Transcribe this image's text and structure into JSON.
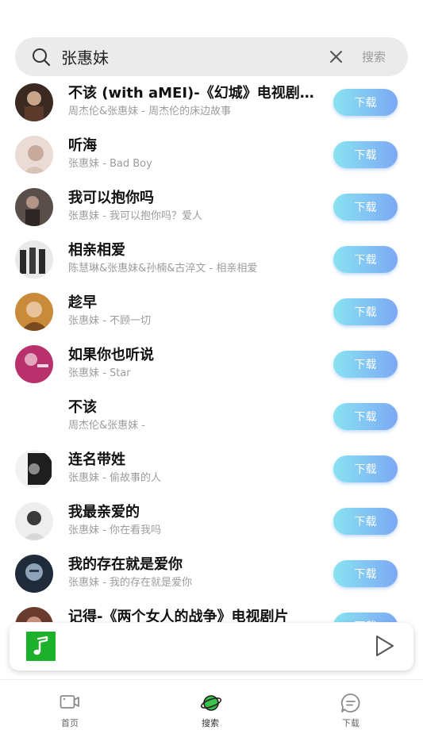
{
  "search": {
    "query": "张惠妹",
    "submit_label": "搜索"
  },
  "songs": [
    {
      "title": "不该 (with aMEI)-《幻城》电视剧片尾曲",
      "subtitle": "周杰伦&张惠妹 - 周杰伦的床边故事",
      "download_label": "下载"
    },
    {
      "title": "听海",
      "subtitle": "张惠妹 - Bad Boy",
      "download_label": "下载"
    },
    {
      "title": "我可以抱你吗",
      "subtitle": "张惠妹 - 我可以抱你吗？爱人",
      "download_label": "下载"
    },
    {
      "title": "相亲相爱",
      "subtitle": "陈慧琳&张惠妹&孙楠&古淬文 - 相亲相爱",
      "download_label": "下载"
    },
    {
      "title": "趁早",
      "subtitle": "张惠妹 - 不顾一切",
      "download_label": "下载"
    },
    {
      "title": "如果你也听说",
      "subtitle": "张惠妹 - Star",
      "download_label": "下载"
    },
    {
      "title": "不该",
      "subtitle": "周杰伦&张惠妹 -",
      "download_label": "下载"
    },
    {
      "title": "连名带姓",
      "subtitle": "张惠妹 - 偷故事的人",
      "download_label": "下载"
    },
    {
      "title": "我最亲爱的",
      "subtitle": "张惠妹 - 你在看我吗",
      "download_label": "下载"
    },
    {
      "title": "我的存在就是爱你",
      "subtitle": "张惠妹 - 我的存在就是爱你",
      "download_label": "下载"
    },
    {
      "title": "记得-《两个女人的战争》电视剧片",
      "subtitle": "",
      "download_label": "下载"
    }
  ],
  "player": {
    "art_icon": "music-note-icon",
    "play_icon": "play-icon"
  },
  "tabs": [
    {
      "label": "首页",
      "icon": "video-icon"
    },
    {
      "label": "搜索",
      "icon": "planet-icon"
    },
    {
      "label": "下载",
      "icon": "chat-icon"
    }
  ],
  "colors": {
    "download_gradient_start": "#88e3f1",
    "download_gradient_end": "#7da8f5",
    "search_tab_accent": "#3cc24a",
    "player_art_bg": "#1db02a"
  }
}
